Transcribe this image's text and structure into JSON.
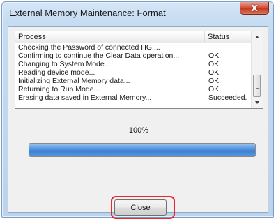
{
  "window": {
    "title": "External Memory Maintenance: Format",
    "close_glyph": "X"
  },
  "list": {
    "columns": {
      "process": "Process",
      "status": "Status"
    },
    "rows": [
      {
        "process": "Checking the Password of connected HG ...",
        "status": ""
      },
      {
        "process": "Confirming to continue the Clear Data operation...",
        "status": "OK."
      },
      {
        "process": "Changing to System Mode...",
        "status": "OK."
      },
      {
        "process": "Reading device mode...",
        "status": "OK."
      },
      {
        "process": "Initializing External Memory data...",
        "status": "OK."
      },
      {
        "process": "Returning to Run Mode...",
        "status": "OK."
      },
      {
        "process": "Erasing data saved in External Memory...",
        "status": "Succeeded."
      }
    ]
  },
  "progress": {
    "label": "100%",
    "value": 1.0
  },
  "buttons": {
    "close": "Close"
  },
  "colors": {
    "highlight": "#e8262f",
    "progress_fill": "#3b7fd4",
    "title_close": "#c13a22"
  }
}
